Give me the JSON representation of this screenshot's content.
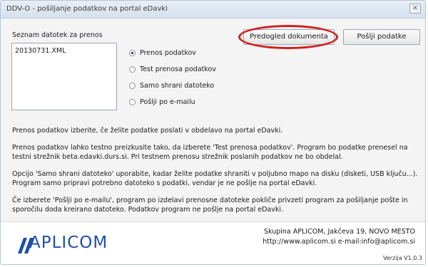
{
  "window": {
    "title": "DDV-O - pošiljanje podatkov na portal eDavki",
    "close_label": "✕"
  },
  "files": {
    "label": "Seznam datotek za prenos",
    "items": [
      "20130731.XML"
    ]
  },
  "options": {
    "selected_index": 0,
    "items": [
      "Prenos podatkov",
      "Test prenosa podatkov",
      "Samo shrani datoteko",
      "Pošlji po e-mailu"
    ]
  },
  "buttons": {
    "preview": "Predogled dokumenta",
    "send": "Pošlji podatke"
  },
  "info": [
    "Prenos podatkov izberite, če želite podatke poslati v obdelavo na portal eDavki.",
    "Prenos podatkov lahko testno preizkusite tako, da izberete 'Test prenosa podatkov'. Program bo podatke prenesel na testni strežnik beta.edavki.durs.si. Pri testnem prenosu strežnik poslanih podatkov ne bo obdelal.",
    "Opcijo 'Samo shrani datoteko' uporabite, kadar želite podatke shraniti v poljubno mapo na disku (disketi, USB ključu...). Program samo pripravi potrebno datoteko s podatki, vendar je ne pošlje na portal eDavki.",
    "Če izberete 'Pošlji po e-mailu', program po izdelavi prenosne datoteke pokliče privzeti program za pošiljanje pošte in sporočilu doda kreirano datoteko. Podatkov program ne pošlje na portal eDavki."
  ],
  "footer": {
    "logo_text": "APLICOM",
    "company_line": "Skupina APLICOM, Jakčeva 19, NOVO MESTO",
    "contact_line": "http://www.aplicom.si  e-mail:info@aplicom.si",
    "version": "Verzija V1.0.3"
  },
  "colors": {
    "highlight": "#d21f1f",
    "logo": "#1f4fa8",
    "titlebar": "#d6e1ee"
  }
}
